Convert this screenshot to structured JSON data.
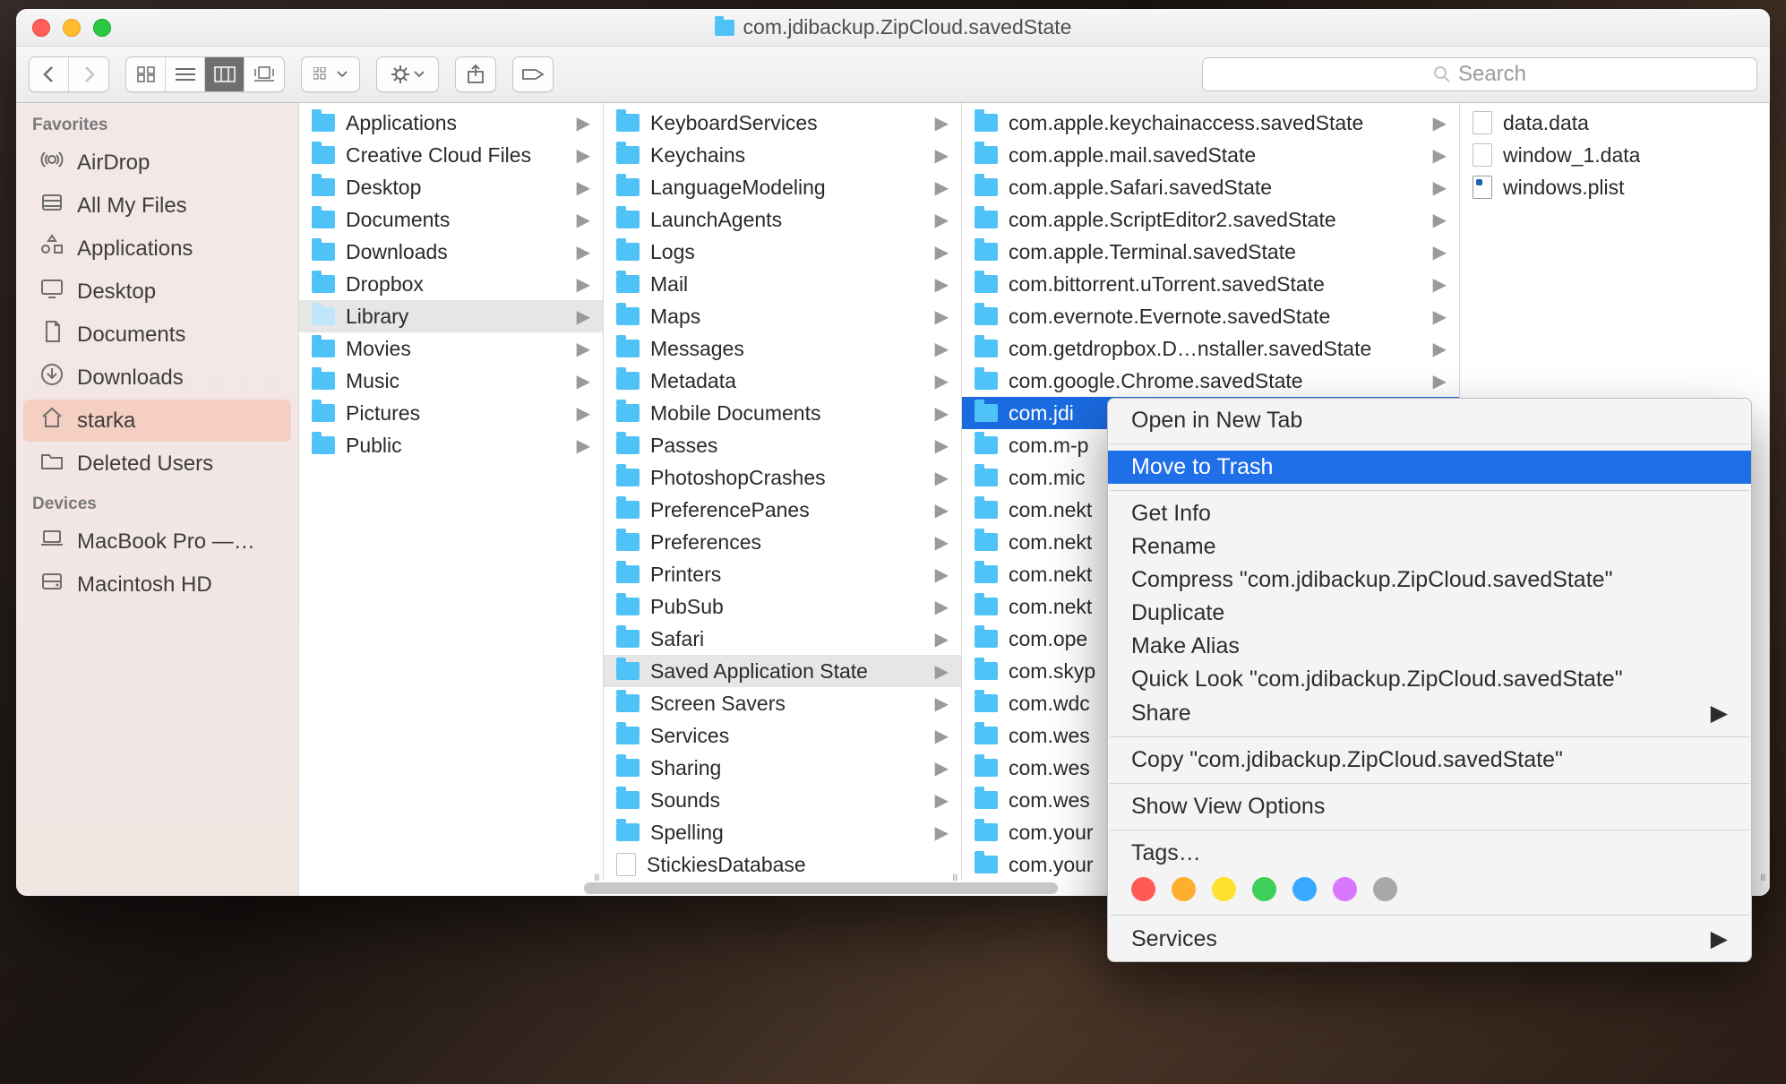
{
  "window": {
    "title": "com.jdibackup.ZipCloud.savedState"
  },
  "search": {
    "placeholder": "Search"
  },
  "sidebar": {
    "sections": [
      {
        "title": "Favorites",
        "items": [
          {
            "label": "AirDrop",
            "icon": "airdrop"
          },
          {
            "label": "All My Files",
            "icon": "allfiles"
          },
          {
            "label": "Applications",
            "icon": "apps"
          },
          {
            "label": "Desktop",
            "icon": "desktop"
          },
          {
            "label": "Documents",
            "icon": "documents"
          },
          {
            "label": "Downloads",
            "icon": "downloads"
          },
          {
            "label": "starka",
            "icon": "home",
            "selected": true
          },
          {
            "label": "Deleted Users",
            "icon": "folder"
          }
        ]
      },
      {
        "title": "Devices",
        "items": [
          {
            "label": "MacBook Pro —…",
            "icon": "laptop"
          },
          {
            "label": "Macintosh HD",
            "icon": "hdd"
          }
        ]
      }
    ]
  },
  "columns": [
    {
      "items": [
        {
          "label": "Applications",
          "type": "folder"
        },
        {
          "label": "Creative Cloud Files",
          "type": "folder"
        },
        {
          "label": "Desktop",
          "type": "folder"
        },
        {
          "label": "Documents",
          "type": "folder"
        },
        {
          "label": "Downloads",
          "type": "folder"
        },
        {
          "label": "Dropbox",
          "type": "folder"
        },
        {
          "label": "Library",
          "type": "folder",
          "selected": true,
          "dim": true
        },
        {
          "label": "Movies",
          "type": "folder"
        },
        {
          "label": "Music",
          "type": "folder"
        },
        {
          "label": "Pictures",
          "type": "folder"
        },
        {
          "label": "Public",
          "type": "folder"
        }
      ]
    },
    {
      "items": [
        {
          "label": "KeyboardServices",
          "type": "folder"
        },
        {
          "label": "Keychains",
          "type": "folder"
        },
        {
          "label": "LanguageModeling",
          "type": "folder"
        },
        {
          "label": "LaunchAgents",
          "type": "folder"
        },
        {
          "label": "Logs",
          "type": "folder"
        },
        {
          "label": "Mail",
          "type": "folder"
        },
        {
          "label": "Maps",
          "type": "folder"
        },
        {
          "label": "Messages",
          "type": "folder"
        },
        {
          "label": "Metadata",
          "type": "folder"
        },
        {
          "label": "Mobile Documents",
          "type": "folder"
        },
        {
          "label": "Passes",
          "type": "folder"
        },
        {
          "label": "PhotoshopCrashes",
          "type": "folder"
        },
        {
          "label": "PreferencePanes",
          "type": "folder"
        },
        {
          "label": "Preferences",
          "type": "folder"
        },
        {
          "label": "Printers",
          "type": "folder"
        },
        {
          "label": "PubSub",
          "type": "folder"
        },
        {
          "label": "Safari",
          "type": "folder"
        },
        {
          "label": "Saved Application State",
          "type": "folder",
          "selected": true
        },
        {
          "label": "Screen Savers",
          "type": "folder"
        },
        {
          "label": "Services",
          "type": "folder"
        },
        {
          "label": "Sharing",
          "type": "folder"
        },
        {
          "label": "Sounds",
          "type": "folder"
        },
        {
          "label": "Spelling",
          "type": "folder"
        },
        {
          "label": "StickiesDatabase",
          "type": "doc"
        }
      ]
    },
    {
      "items": [
        {
          "label": "com.apple.keychainaccess.savedState",
          "type": "folder"
        },
        {
          "label": "com.apple.mail.savedState",
          "type": "folder"
        },
        {
          "label": "com.apple.Safari.savedState",
          "type": "folder"
        },
        {
          "label": "com.apple.ScriptEditor2.savedState",
          "type": "folder"
        },
        {
          "label": "com.apple.Terminal.savedState",
          "type": "folder"
        },
        {
          "label": "com.bittorrent.uTorrent.savedState",
          "type": "folder"
        },
        {
          "label": "com.evernote.Evernote.savedState",
          "type": "folder"
        },
        {
          "label": "com.getdropbox.D…nstaller.savedState",
          "type": "folder"
        },
        {
          "label": "com.google.Chrome.savedState",
          "type": "folder"
        },
        {
          "label": "com.jdibackup.ZipCloud.savedState",
          "type": "folder",
          "highlighted": true,
          "trunc": "com.jdi"
        },
        {
          "label": "com.m-p",
          "type": "folder",
          "trunc": "com.m-p"
        },
        {
          "label": "com.mic",
          "type": "folder",
          "trunc": "com.mic"
        },
        {
          "label": "com.nekt",
          "type": "folder",
          "trunc": "com.nekt"
        },
        {
          "label": "com.nekt",
          "type": "folder",
          "trunc": "com.nekt"
        },
        {
          "label": "com.nekt",
          "type": "folder",
          "trunc": "com.nekt"
        },
        {
          "label": "com.nekt",
          "type": "folder",
          "trunc": "com.nekt"
        },
        {
          "label": "com.ope",
          "type": "folder",
          "trunc": "com.ope"
        },
        {
          "label": "com.skyp",
          "type": "folder",
          "trunc": "com.skyp"
        },
        {
          "label": "com.wdc",
          "type": "folder",
          "trunc": "com.wdc"
        },
        {
          "label": "com.wes",
          "type": "folder",
          "trunc": "com.wes"
        },
        {
          "label": "com.wes",
          "type": "folder",
          "trunc": "com.wes"
        },
        {
          "label": "com.wes",
          "type": "folder",
          "trunc": "com.wes"
        },
        {
          "label": "com.your",
          "type": "folder",
          "trunc": "com.your"
        },
        {
          "label": "com.your",
          "type": "folder",
          "trunc": "com.your"
        }
      ]
    },
    {
      "items": [
        {
          "label": "data.data",
          "type": "doc"
        },
        {
          "label": "window_1.data",
          "type": "doc"
        },
        {
          "label": "windows.plist",
          "type": "plist"
        }
      ]
    }
  ],
  "context_menu": {
    "items": [
      {
        "label": "Open in New Tab"
      },
      {
        "sep": true
      },
      {
        "label": "Move to Trash",
        "highlighted": true
      },
      {
        "sep": true
      },
      {
        "label": "Get Info"
      },
      {
        "label": "Rename"
      },
      {
        "label": "Compress \"com.jdibackup.ZipCloud.savedState\""
      },
      {
        "label": "Duplicate"
      },
      {
        "label": "Make Alias"
      },
      {
        "label": "Quick Look \"com.jdibackup.ZipCloud.savedState\""
      },
      {
        "label": "Share",
        "submenu": true
      },
      {
        "sep": true
      },
      {
        "label": "Copy \"com.jdibackup.ZipCloud.savedState\""
      },
      {
        "sep": true
      },
      {
        "label": "Show View Options"
      },
      {
        "sep": true
      },
      {
        "label": "Tags…"
      },
      {
        "tags": true
      },
      {
        "sep": true
      },
      {
        "label": "Services",
        "submenu": true
      }
    ],
    "tag_colors": [
      "#ff5b54",
      "#ffae2f",
      "#ffe12f",
      "#3fd05b",
      "#39a9ff",
      "#d977ff",
      "#a8a8a8"
    ]
  }
}
